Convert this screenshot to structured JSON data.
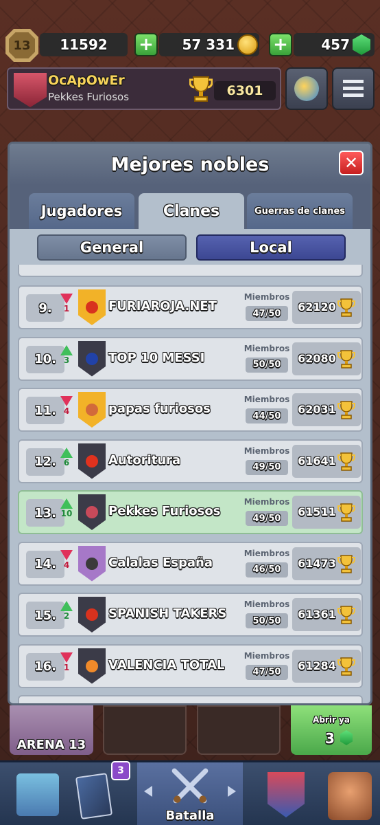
{
  "topbar": {
    "level": "13",
    "experience": "11592",
    "gold": "57 331",
    "gems": "457"
  },
  "profile": {
    "player_name": "OcApOwEr",
    "clan_name": "Pekkes Furiosos",
    "trophies": "6301"
  },
  "modal": {
    "title": "Mejores nobles",
    "close_label": "✕",
    "tabs": [
      {
        "label": "Jugadores",
        "active": false
      },
      {
        "label": "Clanes",
        "active": true
      },
      {
        "label": "Guerras de clanes",
        "active": false
      }
    ],
    "subtabs": [
      {
        "label": "General",
        "active": false
      },
      {
        "label": "Local",
        "active": true
      }
    ],
    "members_label": "Miembros",
    "rows": [
      {
        "rank": "9.",
        "direction": "down",
        "change": "1",
        "name": "FURIAROJA.NET",
        "members": "47/50",
        "score": "62120",
        "badge_color": "#f2b228",
        "emblem": "#d8321e",
        "self": false
      },
      {
        "rank": "10.",
        "direction": "up",
        "change": "3",
        "name": "TOP 10 MESSI",
        "members": "50/50",
        "score": "62080",
        "badge_color": "#3b3b48",
        "emblem": "#2142a8",
        "self": false
      },
      {
        "rank": "11.",
        "direction": "down",
        "change": "4",
        "name": "papas furiosos",
        "members": "44/50",
        "score": "62031",
        "badge_color": "#f2b228",
        "emblem": "#d26a3a",
        "self": false
      },
      {
        "rank": "12.",
        "direction": "up",
        "change": "6",
        "name": "Autoritura",
        "members": "49/50",
        "score": "61641",
        "badge_color": "#3b3b48",
        "emblem": "#e0321e",
        "self": false
      },
      {
        "rank": "13.",
        "direction": "up",
        "change": "10",
        "name": "Pekkes Furiosos",
        "members": "49/50",
        "score": "61511",
        "badge_color": "#3b3b48",
        "emblem": "#c84a5a",
        "self": true
      },
      {
        "rank": "14.",
        "direction": "down",
        "change": "4",
        "name": "Calalas España",
        "members": "46/50",
        "score": "61473",
        "badge_color": "#a678c8",
        "emblem": "#3a3a3a",
        "self": false
      },
      {
        "rank": "15.",
        "direction": "up",
        "change": "2",
        "name": "SPANISH TAKERS",
        "members": "50/50",
        "score": "61361",
        "badge_color": "#3b3b48",
        "emblem": "#d8321e",
        "self": false
      },
      {
        "rank": "16.",
        "direction": "down",
        "change": "1",
        "name": "VALENCIA TOTAL",
        "members": "47/50",
        "score": "61284",
        "badge_color": "#3b3b48",
        "emblem": "#f08a2a",
        "self": false
      }
    ]
  },
  "bottom": {
    "arena_label": "ARENA 13",
    "chest_open_label": "Abrir ya",
    "chest_count": "3"
  },
  "navbar": {
    "cards_badge": "3",
    "battle_label": "Batalla"
  },
  "colors": {
    "arrow_up": "#3fbf5a",
    "arrow_down": "#e0315a",
    "self_row": "#c3e6c7",
    "accent_local": "#3c4792"
  }
}
